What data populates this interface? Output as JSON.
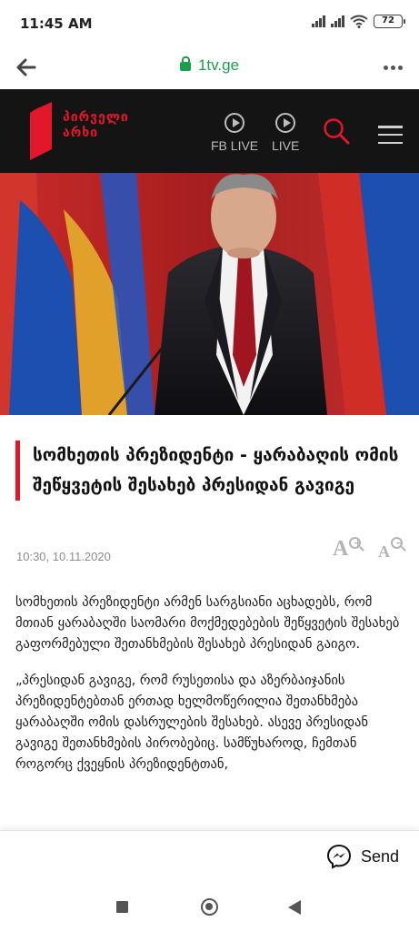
{
  "status_bar": {
    "time": "11:45 AM",
    "battery": "72"
  },
  "browser": {
    "url": "1tv.ge"
  },
  "site": {
    "logo_line1": "პირველი",
    "logo_line2": "არხი",
    "fb_live_label": "FB LIVE",
    "live_label": "LIVE",
    "brand_color": "#e3172a"
  },
  "article": {
    "headline": "სომხეთის პრეზიდენტი - ყარაბაღის ომის შეწყვეტის შესახებ პრესიდან გავიგე",
    "date": "10:30, 10.11.2020",
    "paragraphs": [
      "სომხეთის პრეზიდენტი არმენ სარგსიანი აცხადებს, რომ მთიან ყარაბაღში საომარი მოქმედებების შეწყვეტის შესახებ გაფორმებული შეთანხმების შესახებ პრესიდან გაიგო.",
      "„პრესიდან გავიგე, რომ რუსეთისა და აზერბაიჯანის პრეზიდენტებთან ერთად ხელმოწერილია შეთანხმება ყარაბაღში ომის დასრულების შესახებ. ასევე პრესიდან გავიგე შეთანხმების პირობებიც. სამწუხაროდ, ჩემთან როგორც ქვეყნის პრეზიდენტთან,"
    ]
  },
  "messenger": {
    "send_label": "Send"
  },
  "icons": {
    "back": "arrow-left-icon",
    "lock": "lock-icon",
    "more": "more-vert-icon",
    "play": "play-circle-icon",
    "search": "search-icon",
    "menu": "hamburger-icon",
    "font_up": "font-increase-icon",
    "font_down": "font-decrease-icon",
    "messenger": "messenger-icon"
  }
}
